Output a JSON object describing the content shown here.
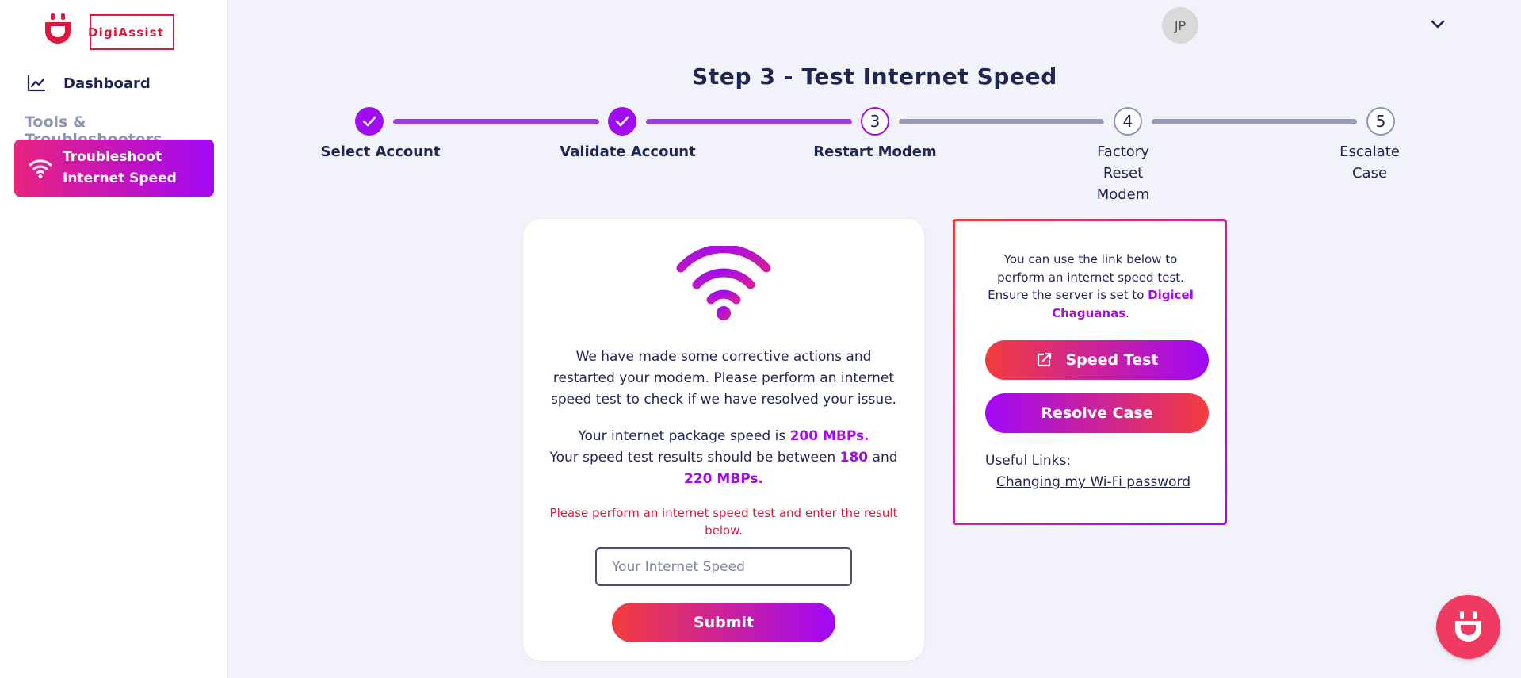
{
  "brand": {
    "name": "DigiAssist",
    "color": "#e0163d"
  },
  "sidebar": {
    "dashboard_label": "Dashboard",
    "section_label": "Tools & Troubleshooters",
    "active_item_label": "Troubleshoot Internet Speed"
  },
  "header": {
    "avatar_initials": "JP"
  },
  "page": {
    "title": "Step 3 - Test Internet Speed"
  },
  "stepper": {
    "current": 3,
    "steps": [
      {
        "number": "1",
        "label": "Select Account",
        "status": "done"
      },
      {
        "number": "2",
        "label": "Validate Account",
        "status": "done"
      },
      {
        "number": "3",
        "label": "Restart Modem",
        "status": "current"
      },
      {
        "number": "4",
        "label": "Factory Reset Modem",
        "status": "todo"
      },
      {
        "number": "5",
        "label": "Escalate Case",
        "status": "todo"
      }
    ]
  },
  "main_card": {
    "intro": "We have made some corrective actions and restarted your modem. Please perform an internet speed test to check if we have resolved your issue.",
    "package_prefix": "Your internet package speed is ",
    "package_speed": "200 MBPs.",
    "range_prefix": "Your speed test results should be between ",
    "range_low": "180",
    "range_and": " and ",
    "range_high": "220 MBPs.",
    "warning": "Please perform an internet speed test and enter the result below.",
    "input_placeholder": "Your Internet Speed",
    "input_value": "",
    "submit_label": "Submit"
  },
  "side_card": {
    "text_prefix": "You can use the link below to perform an internet speed test. Ensure the server is set to ",
    "server_name": "Digicel Chaguanas",
    "text_suffix": ".",
    "speed_test_label": "Speed Test",
    "resolve_label": "Resolve Case",
    "useful_links_label": "Useful Links:",
    "link_label": "Changing my Wi-Fi password"
  },
  "colors": {
    "accent_purple": "#a10cf0",
    "accent_red": "#f43d3d",
    "navy": "#1f2551",
    "warning": "#e0163d"
  },
  "icons": [
    "digiassist-logo-icon",
    "chart-line-icon",
    "wifi-icon",
    "chevron-down-icon",
    "check-icon",
    "external-link-icon",
    "chat-bot-icon"
  ]
}
